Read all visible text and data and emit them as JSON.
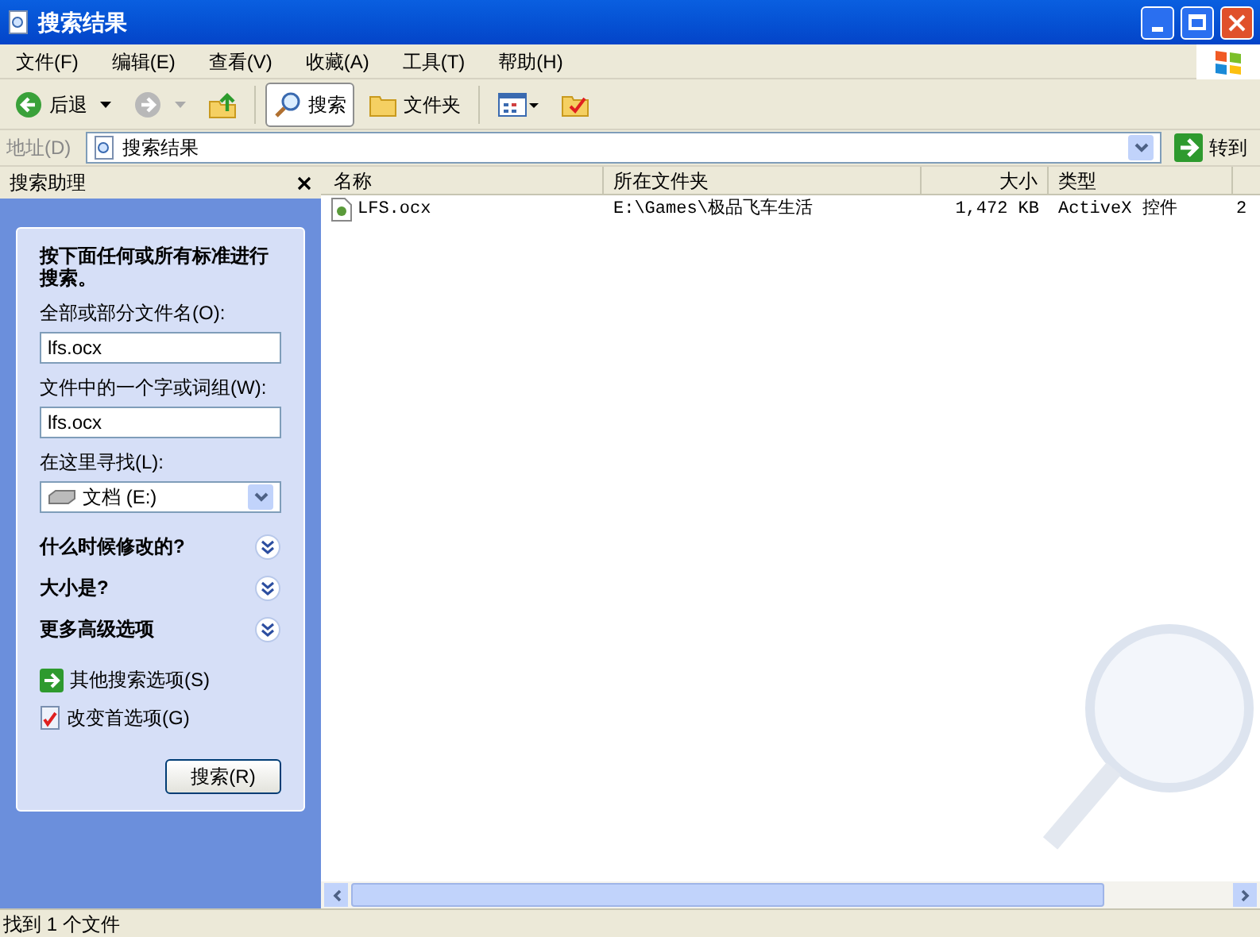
{
  "window": {
    "title": "搜索结果"
  },
  "menu": [
    "文件(F)",
    "编辑(E)",
    "查看(V)",
    "收藏(A)",
    "工具(T)",
    "帮助(H)"
  ],
  "toolbar": [
    {
      "kind": "back",
      "label": "后退",
      "disabled": false
    },
    {
      "kind": "forward",
      "disabled": true
    },
    {
      "kind": "up"
    },
    {
      "kind": "search",
      "label": "搜索",
      "selected": true
    },
    {
      "kind": "folders",
      "label": "文件夹",
      "selected": false
    },
    {
      "kind": "views"
    },
    {
      "kind": "favorites"
    }
  ],
  "address": {
    "label": "地址(D)",
    "value": "搜索结果",
    "go": "转到"
  },
  "search_pane": {
    "title": "搜索助理",
    "heading": "按下面任何或所有标准进行搜索。",
    "fields": [
      {
        "kind": "text",
        "label": "全部或部分文件名(O):",
        "value": "lfs.ocx"
      },
      {
        "kind": "text",
        "label": "文件中的一个字或词组(W):",
        "value": "lfs.ocx"
      },
      {
        "kind": "select",
        "label": "在这里寻找(L):",
        "value": "文档 (E:)"
      }
    ],
    "sections": [
      {
        "label": "什么时候修改的?",
        "expanded": false
      },
      {
        "label": "大小是?",
        "expanded": false
      },
      {
        "label": "更多高级选项",
        "expanded": false
      }
    ],
    "links": [
      {
        "kind": "arrow",
        "label": "其他搜索选项(S)"
      },
      {
        "kind": "prefs",
        "label": "改变首选项(G)"
      }
    ],
    "button": "搜索(R)"
  },
  "table": {
    "columns": [
      "名称",
      "所在文件夹",
      "大小",
      "类型"
    ],
    "rows": [
      {
        "name": "LFS.ocx",
        "folder": "E:\\Games\\极品飞车生活",
        "size": "1,472 KB",
        "type": "ActiveX 控件",
        "column_5": "2"
      }
    ]
  },
  "status_bar": "找到 1 个文件"
}
